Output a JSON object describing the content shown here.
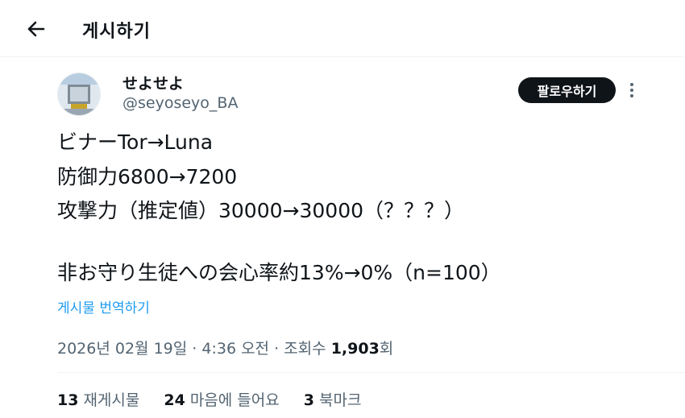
{
  "header": {
    "title": "게시하기",
    "back_icon": "arrow-left-icon"
  },
  "author": {
    "display_name": "せよせよ",
    "handle": "@seyoseyo_BA",
    "follow_label": "팔로우하기"
  },
  "tweet": {
    "lines": [
      "ビナーTor→Luna",
      "防御力6800→7200",
      "攻撃力（推定値）30000→30000（？？？）",
      "非お守り生徒への会心率約13%→0%（n=100）"
    ],
    "translate_label": "게시물 번역하기"
  },
  "meta": {
    "date": "2026년 02월 19일",
    "time": "4:36 오전",
    "views_label": "조회수",
    "views_count": "1,903",
    "views_suffix": "회"
  },
  "stats": {
    "reposts_count": "13",
    "reposts_label": "재게시물",
    "likes_count": "24",
    "likes_label": "마음에 들어요",
    "bookmarks_count": "3",
    "bookmarks_label": "북마크"
  }
}
